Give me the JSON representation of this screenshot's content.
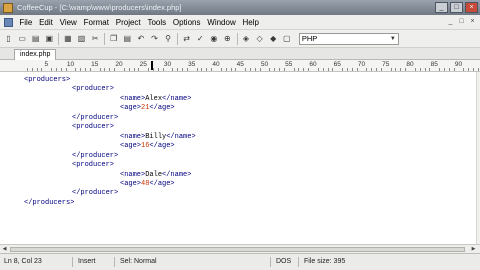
{
  "window": {
    "title": "CoffeeCup - [C:\\wamp\\www\\producers\\index.php]",
    "minimize": "_",
    "maximize": "□",
    "close": "×"
  },
  "menu": [
    "File",
    "Edit",
    "View",
    "Format",
    "Project",
    "Tools",
    "Options",
    "Window",
    "Help"
  ],
  "menu_controls": [
    "_",
    "□",
    "×"
  ],
  "toolbar": {
    "buttons": [
      {
        "name": "new-file-icon",
        "glyph": "▯"
      },
      {
        "name": "open-folder-icon",
        "glyph": "▭"
      },
      {
        "name": "open-file-icon",
        "glyph": "▤"
      },
      {
        "name": "save-icon",
        "glyph": "▣"
      },
      {
        "name": "save-all-icon",
        "glyph": "▦"
      },
      {
        "name": "close-file-icon",
        "glyph": "▧"
      },
      {
        "name": "cut-icon",
        "glyph": "✂"
      },
      {
        "name": "copy-icon",
        "glyph": "❐"
      },
      {
        "name": "paste-icon",
        "glyph": "▤"
      },
      {
        "name": "undo-icon",
        "glyph": "↶"
      },
      {
        "name": "redo-icon",
        "glyph": "↷"
      },
      {
        "name": "find-icon",
        "glyph": "⚲"
      },
      {
        "name": "replace-icon",
        "glyph": "⇄"
      },
      {
        "name": "spell-check-icon",
        "glyph": "✓"
      },
      {
        "name": "preview-icon",
        "glyph": "◉"
      },
      {
        "name": "zoom-icon",
        "glyph": "⊕"
      },
      {
        "name": "tag-insert-icon",
        "glyph": "◈"
      },
      {
        "name": "tag-wizard-icon",
        "glyph": "◇"
      },
      {
        "name": "tag-edit-icon",
        "glyph": "◆"
      },
      {
        "name": "comment-icon",
        "glyph": "▢"
      }
    ],
    "language": "PHP"
  },
  "tabs": [
    {
      "label": "index.php"
    }
  ],
  "ruler": [
    "5",
    "10",
    "15",
    "20",
    "25",
    "30",
    "35",
    "40",
    "45",
    "50",
    "55",
    "60",
    "65",
    "70",
    "75",
    "80",
    "85",
    "90",
    "95"
  ],
  "code": [
    {
      "indent": 0,
      "parts": [
        [
          "tag",
          "<producers>"
        ]
      ]
    },
    {
      "indent": 1,
      "parts": [
        [
          "tag",
          "<producer>"
        ]
      ]
    },
    {
      "indent": 2,
      "parts": [
        [
          "tag",
          "<name>"
        ],
        [
          "plain",
          "Alex"
        ],
        [
          "tag",
          "</name>"
        ]
      ]
    },
    {
      "indent": 2,
      "parts": [
        [
          "tag",
          "<age>"
        ],
        [
          "val",
          "21"
        ],
        [
          "tag",
          "</age>"
        ]
      ]
    },
    {
      "indent": 1,
      "parts": [
        [
          "tag",
          "</producer>"
        ]
      ]
    },
    {
      "indent": 1,
      "parts": [
        [
          "tag",
          "<producer>"
        ]
      ]
    },
    {
      "indent": 2,
      "parts": [
        [
          "tag",
          "<name>"
        ],
        [
          "plain",
          "Billy"
        ],
        [
          "tag",
          "</name>"
        ]
      ]
    },
    {
      "indent": 2,
      "parts": [
        [
          "tag",
          "<age>"
        ],
        [
          "val",
          "16"
        ],
        [
          "tag",
          "</age>"
        ]
      ]
    },
    {
      "indent": 1,
      "parts": [
        [
          "tag",
          "</producer>"
        ]
      ]
    },
    {
      "indent": 1,
      "parts": [
        [
          "tag",
          "<producer>"
        ]
      ]
    },
    {
      "indent": 2,
      "parts": [
        [
          "tag",
          "<name>"
        ],
        [
          "plain",
          "Dale"
        ],
        [
          "tag",
          "</name>"
        ]
      ]
    },
    {
      "indent": 2,
      "parts": [
        [
          "tag",
          "<age>"
        ],
        [
          "val",
          "48"
        ],
        [
          "tag",
          "</age>"
        ]
      ]
    },
    {
      "indent": 1,
      "parts": [
        [
          "tag",
          "</producer>"
        ]
      ]
    },
    {
      "indent": 0,
      "parts": [
        [
          "tag",
          "</producers>"
        ]
      ]
    }
  ],
  "status": {
    "position": "Ln 8, Col 23",
    "mode": "Insert",
    "selection": "Sel: Normal",
    "encoding": "DOS",
    "filesize": "File size: 395"
  },
  "colors": {
    "tag": "#000080",
    "value": "#cc3300"
  }
}
